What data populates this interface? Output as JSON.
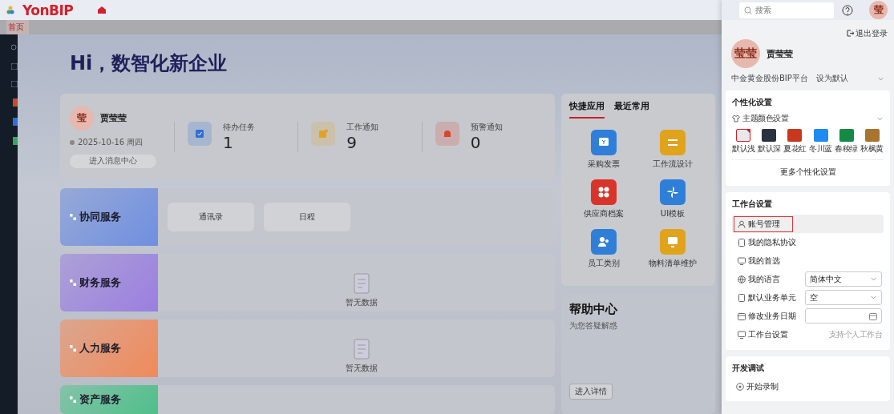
{
  "header": {
    "logo": "YonBIP"
  },
  "tabs": [
    {
      "label": "首页",
      "selected": true
    }
  ],
  "greeting": "Hi，数智化新企业",
  "user_card": {
    "avatar": "莹",
    "name": "贾莹莹",
    "date": "2025-10-16 周四",
    "button": "进入消息中心"
  },
  "stats": [
    {
      "kind": "task",
      "label": "待办任务",
      "value": "1",
      "color": "#2f6fd6"
    },
    {
      "kind": "notice",
      "label": "工作通知",
      "value": "9",
      "color": "#e3a21f"
    },
    {
      "kind": "alert",
      "label": "预警通知",
      "value": "0",
      "color": "#d6452f"
    }
  ],
  "services": [
    {
      "title": "协同服务",
      "color": "#6f8fe0",
      "links": [
        "通讯录",
        "日程"
      ]
    },
    {
      "title": "财务服务",
      "color": "#9a7fe0",
      "empty": "暂无数据"
    },
    {
      "title": "人力服务",
      "color": "#f08a5a",
      "empty": "暂无数据"
    },
    {
      "title": "资产服务",
      "color": "#4fbf8a"
    }
  ],
  "quick_apps": {
    "tabs": [
      {
        "label": "快捷应用",
        "selected": true
      },
      {
        "label": "最近常用",
        "selected": false
      }
    ],
    "apps": [
      {
        "label": "采购发票",
        "color": "#2f7fd8",
        "kind": "invoice"
      },
      {
        "label": "工作流设计",
        "color": "#e0a31c",
        "kind": "flow"
      },
      {
        "label": "供应商档案",
        "color": "#d8342a",
        "kind": "grid"
      },
      {
        "label": "UI模板",
        "color": "#2f7fd8",
        "kind": "pinwheel"
      },
      {
        "label": "员工类别",
        "color": "#2f7fd8",
        "kind": "people"
      },
      {
        "label": "物料清单维护",
        "color": "#e0a31c",
        "kind": "screen"
      }
    ]
  },
  "help": {
    "title": "帮助中心",
    "subtitle": "为您答疑解惑",
    "button": "进入详情"
  },
  "drawer": {
    "search": {
      "placeholder": "搜索"
    },
    "avatar": "莹",
    "logout": "退出登录",
    "profile": {
      "avatar": "莹莹",
      "name": "贾莹莹"
    },
    "org": {
      "name": "中金黄金股份BIP平台",
      "action": "设为默认"
    },
    "personal": {
      "title": "个性化设置",
      "theme_label": "主题颜色设置",
      "themes": [
        {
          "label": "默认浅",
          "color": "#e6e8ec",
          "selected": true
        },
        {
          "label": "默认深",
          "color": "#2a3140",
          "selected": false
        },
        {
          "label": "夏花红",
          "color": "#c8381f",
          "selected": false
        },
        {
          "label": "冬川蓝",
          "color": "#1f8af0",
          "selected": false
        },
        {
          "label": "春秧绿",
          "color": "#158a45",
          "selected": false
        },
        {
          "label": "秋枫黄",
          "color": "#a8742f",
          "selected": false
        }
      ],
      "more": "更多个性化设置"
    },
    "workbench": {
      "title": "工作台设置",
      "items": [
        {
          "kind": "link",
          "label": "账号管理",
          "selected": true
        },
        {
          "kind": "link",
          "label": "我的隐私协议",
          "selected": false
        },
        {
          "kind": "link",
          "label": "我的首选",
          "selected": false
        },
        {
          "kind": "select",
          "label": "我的语言",
          "value": "简体中文",
          "selected": false
        },
        {
          "kind": "select",
          "label": "默认业务单元",
          "value": "空",
          "selected": false
        },
        {
          "kind": "date",
          "label": "修改业务日期",
          "selected": false
        },
        {
          "kind": "note",
          "label": "工作台设置",
          "note": "支持个人工作台",
          "selected": false
        }
      ]
    },
    "dev": {
      "title": "开发调试",
      "items": [
        "开始录制"
      ]
    }
  }
}
